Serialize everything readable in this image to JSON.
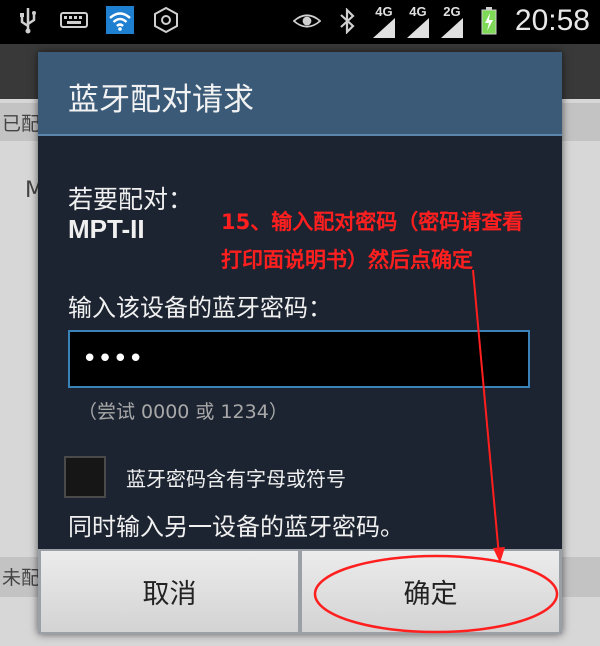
{
  "status_bar": {
    "icons": [
      "usb-icon",
      "keyboard-icon",
      "wifi-icon",
      "hexagon-icon",
      "eye-icon",
      "bluetooth-icon"
    ],
    "signals": [
      {
        "label": "4G",
        "icon": "signal-icon"
      },
      {
        "label": "4G",
        "icon": "signal-icon"
      },
      {
        "label": "2G",
        "icon": "signal-icon"
      }
    ],
    "time": "20:58"
  },
  "background": {
    "section_paired": "已配",
    "item_partial": "M",
    "section_unpaired": "未配"
  },
  "dialog": {
    "title": "蓝牙配对请求",
    "pair_with_label": "若要配对：",
    "device_name": "MPT-II",
    "enter_pin_label": "输入该设备的蓝牙密码：",
    "pin_value": "••••",
    "pin_hint": "（尝试 0000 或 1234）",
    "checkbox_label": "蓝牙密码含有字母或符号",
    "also_enter_label": "同时输入另一设备的蓝牙密码。",
    "cancel_label": "取消",
    "ok_label": "确定"
  },
  "annotation": {
    "line1": "15、输入配对密码（密码请查看",
    "line2": "打印面说明书）然后点确定",
    "color": "#ff1f1f"
  }
}
